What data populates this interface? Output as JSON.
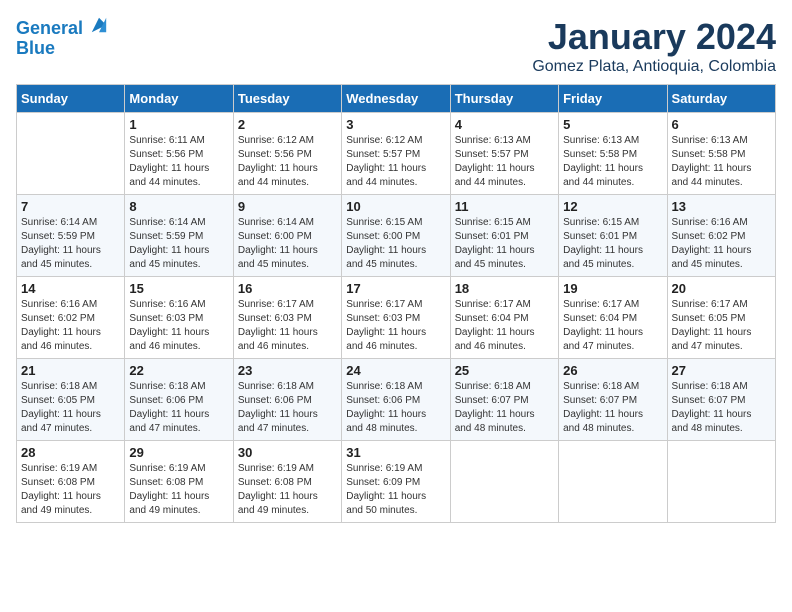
{
  "header": {
    "logo_line1": "General",
    "logo_line2": "Blue",
    "month_title": "January 2024",
    "subtitle": "Gomez Plata, Antioquia, Colombia"
  },
  "days_of_week": [
    "Sunday",
    "Monday",
    "Tuesday",
    "Wednesday",
    "Thursday",
    "Friday",
    "Saturday"
  ],
  "weeks": [
    [
      {
        "day": "",
        "info": ""
      },
      {
        "day": "1",
        "info": "Sunrise: 6:11 AM\nSunset: 5:56 PM\nDaylight: 11 hours\nand 44 minutes."
      },
      {
        "day": "2",
        "info": "Sunrise: 6:12 AM\nSunset: 5:56 PM\nDaylight: 11 hours\nand 44 minutes."
      },
      {
        "day": "3",
        "info": "Sunrise: 6:12 AM\nSunset: 5:57 PM\nDaylight: 11 hours\nand 44 minutes."
      },
      {
        "day": "4",
        "info": "Sunrise: 6:13 AM\nSunset: 5:57 PM\nDaylight: 11 hours\nand 44 minutes."
      },
      {
        "day": "5",
        "info": "Sunrise: 6:13 AM\nSunset: 5:58 PM\nDaylight: 11 hours\nand 44 minutes."
      },
      {
        "day": "6",
        "info": "Sunrise: 6:13 AM\nSunset: 5:58 PM\nDaylight: 11 hours\nand 44 minutes."
      }
    ],
    [
      {
        "day": "7",
        "info": "Sunrise: 6:14 AM\nSunset: 5:59 PM\nDaylight: 11 hours\nand 45 minutes."
      },
      {
        "day": "8",
        "info": "Sunrise: 6:14 AM\nSunset: 5:59 PM\nDaylight: 11 hours\nand 45 minutes."
      },
      {
        "day": "9",
        "info": "Sunrise: 6:14 AM\nSunset: 6:00 PM\nDaylight: 11 hours\nand 45 minutes."
      },
      {
        "day": "10",
        "info": "Sunrise: 6:15 AM\nSunset: 6:00 PM\nDaylight: 11 hours\nand 45 minutes."
      },
      {
        "day": "11",
        "info": "Sunrise: 6:15 AM\nSunset: 6:01 PM\nDaylight: 11 hours\nand 45 minutes."
      },
      {
        "day": "12",
        "info": "Sunrise: 6:15 AM\nSunset: 6:01 PM\nDaylight: 11 hours\nand 45 minutes."
      },
      {
        "day": "13",
        "info": "Sunrise: 6:16 AM\nSunset: 6:02 PM\nDaylight: 11 hours\nand 45 minutes."
      }
    ],
    [
      {
        "day": "14",
        "info": "Sunrise: 6:16 AM\nSunset: 6:02 PM\nDaylight: 11 hours\nand 46 minutes."
      },
      {
        "day": "15",
        "info": "Sunrise: 6:16 AM\nSunset: 6:03 PM\nDaylight: 11 hours\nand 46 minutes."
      },
      {
        "day": "16",
        "info": "Sunrise: 6:17 AM\nSunset: 6:03 PM\nDaylight: 11 hours\nand 46 minutes."
      },
      {
        "day": "17",
        "info": "Sunrise: 6:17 AM\nSunset: 6:03 PM\nDaylight: 11 hours\nand 46 minutes."
      },
      {
        "day": "18",
        "info": "Sunrise: 6:17 AM\nSunset: 6:04 PM\nDaylight: 11 hours\nand 46 minutes."
      },
      {
        "day": "19",
        "info": "Sunrise: 6:17 AM\nSunset: 6:04 PM\nDaylight: 11 hours\nand 47 minutes."
      },
      {
        "day": "20",
        "info": "Sunrise: 6:17 AM\nSunset: 6:05 PM\nDaylight: 11 hours\nand 47 minutes."
      }
    ],
    [
      {
        "day": "21",
        "info": "Sunrise: 6:18 AM\nSunset: 6:05 PM\nDaylight: 11 hours\nand 47 minutes."
      },
      {
        "day": "22",
        "info": "Sunrise: 6:18 AM\nSunset: 6:06 PM\nDaylight: 11 hours\nand 47 minutes."
      },
      {
        "day": "23",
        "info": "Sunrise: 6:18 AM\nSunset: 6:06 PM\nDaylight: 11 hours\nand 47 minutes."
      },
      {
        "day": "24",
        "info": "Sunrise: 6:18 AM\nSunset: 6:06 PM\nDaylight: 11 hours\nand 48 minutes."
      },
      {
        "day": "25",
        "info": "Sunrise: 6:18 AM\nSunset: 6:07 PM\nDaylight: 11 hours\nand 48 minutes."
      },
      {
        "day": "26",
        "info": "Sunrise: 6:18 AM\nSunset: 6:07 PM\nDaylight: 11 hours\nand 48 minutes."
      },
      {
        "day": "27",
        "info": "Sunrise: 6:18 AM\nSunset: 6:07 PM\nDaylight: 11 hours\nand 48 minutes."
      }
    ],
    [
      {
        "day": "28",
        "info": "Sunrise: 6:19 AM\nSunset: 6:08 PM\nDaylight: 11 hours\nand 49 minutes."
      },
      {
        "day": "29",
        "info": "Sunrise: 6:19 AM\nSunset: 6:08 PM\nDaylight: 11 hours\nand 49 minutes."
      },
      {
        "day": "30",
        "info": "Sunrise: 6:19 AM\nSunset: 6:08 PM\nDaylight: 11 hours\nand 49 minutes."
      },
      {
        "day": "31",
        "info": "Sunrise: 6:19 AM\nSunset: 6:09 PM\nDaylight: 11 hours\nand 50 minutes."
      },
      {
        "day": "",
        "info": ""
      },
      {
        "day": "",
        "info": ""
      },
      {
        "day": "",
        "info": ""
      }
    ]
  ]
}
